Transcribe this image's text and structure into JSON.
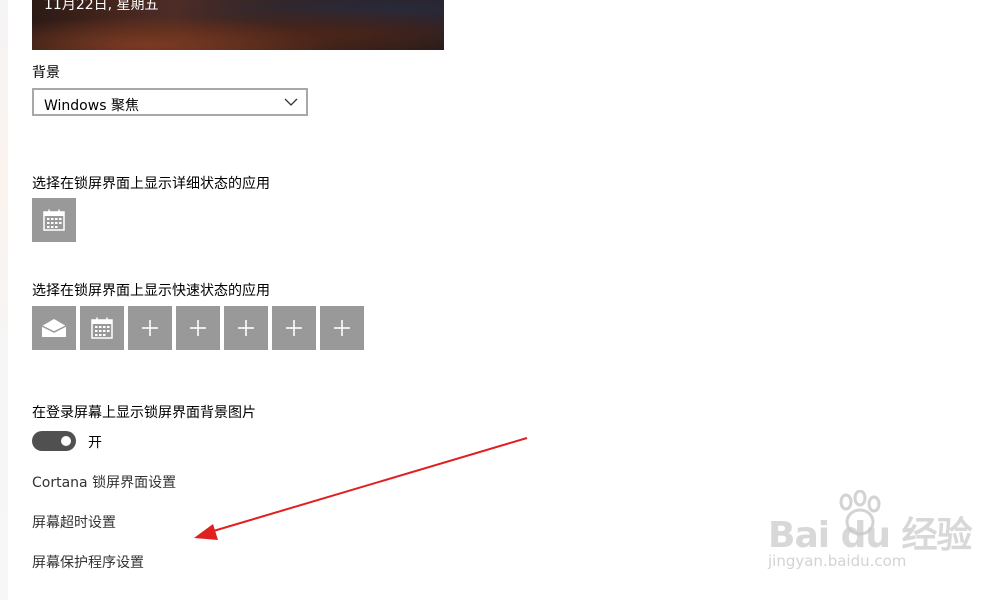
{
  "preview": {
    "date_text": "11月22日, 星期五"
  },
  "background": {
    "label": "背景",
    "selected": "Windows 聚焦"
  },
  "detailed_status": {
    "label": "选择在锁屏界面上显示详细状态的应用"
  },
  "quick_status": {
    "label": "选择在锁屏界面上显示快速状态的应用"
  },
  "login_background": {
    "label": "在登录屏幕上显示锁屏界面背景图片",
    "toggle_state": "开"
  },
  "links": {
    "cortana": "Cortana 锁屏界面设置",
    "timeout": "屏幕超时设置",
    "screensaver": "屏幕保护程序设置"
  },
  "watermark": {
    "main": "Bai du 经验",
    "sub": "jingyan.baidu.com"
  },
  "colors": {
    "tile": "#999999",
    "toggle_on": "#505050",
    "arrow": "#e02020"
  }
}
